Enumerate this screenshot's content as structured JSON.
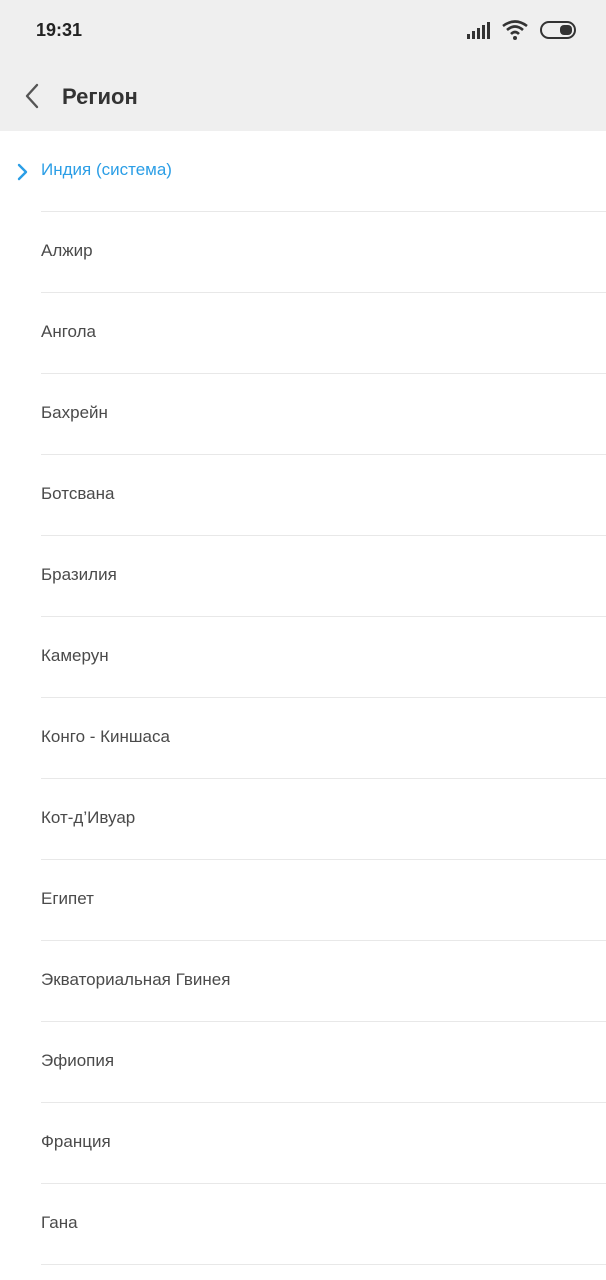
{
  "status_bar": {
    "time": "19:31",
    "icons": [
      "signal-icon",
      "wifi-icon",
      "battery-icon"
    ]
  },
  "header": {
    "title": "Регион",
    "back_icon": "chevron-left-icon"
  },
  "colors": {
    "accent": "#2b9ee6",
    "header_bg": "#efefef",
    "text": "#4a4a4a"
  },
  "regions": [
    {
      "label": "Индия (система)",
      "selected": true
    },
    {
      "label": "Алжир",
      "selected": false
    },
    {
      "label": "Ангола",
      "selected": false
    },
    {
      "label": "Бахрейн",
      "selected": false
    },
    {
      "label": "Ботсвана",
      "selected": false
    },
    {
      "label": "Бразилия",
      "selected": false
    },
    {
      "label": "Камерун",
      "selected": false
    },
    {
      "label": "Конго - Киншаса",
      "selected": false
    },
    {
      "label": "Кот-д’Ивуар",
      "selected": false
    },
    {
      "label": "Египет",
      "selected": false
    },
    {
      "label": "Экваториальная Гвинея",
      "selected": false
    },
    {
      "label": "Эфиопия",
      "selected": false
    },
    {
      "label": "Франция",
      "selected": false
    },
    {
      "label": "Гана",
      "selected": false
    }
  ]
}
